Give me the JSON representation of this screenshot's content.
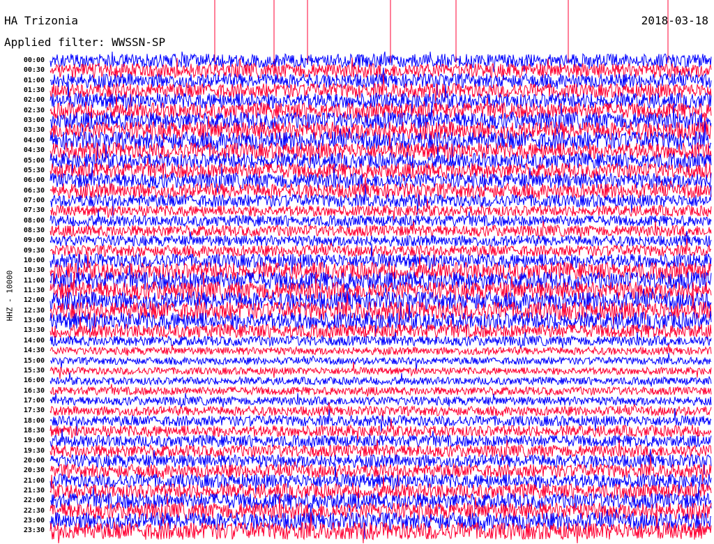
{
  "header": {
    "station": "HA Trizonia",
    "date": "2018-03-18",
    "filter": "Applied filter: WWSSN-SP",
    "channel": "HHZ - 10000"
  },
  "chart_data": {
    "type": "line",
    "title": "HA Trizonia",
    "subtitle": "Applied filter: WWSSN-SP",
    "ylabel": "HHZ - 10000",
    "xlabel": "",
    "rows": [
      "00:00",
      "00:30",
      "01:00",
      "01:30",
      "02:00",
      "02:30",
      "03:00",
      "03:30",
      "04:00",
      "04:30",
      "05:00",
      "05:30",
      "06:00",
      "06:30",
      "07:00",
      "07:30",
      "08:00",
      "08:30",
      "09:00",
      "09:30",
      "10:00",
      "10:30",
      "11:00",
      "11:30",
      "12:00",
      "12:30",
      "13:00",
      "13:30",
      "14:00",
      "14:30",
      "15:00",
      "15:30",
      "16:00",
      "16:30",
      "17:00",
      "17:30",
      "18:00",
      "18:30",
      "19:00",
      "19:30",
      "20:00",
      "20:30",
      "21:00",
      "21:30",
      "22:00",
      "22:30",
      "23:00",
      "23:30"
    ],
    "amplitude": [
      0.75,
      0.8,
      0.78,
      0.8,
      0.85,
      0.88,
      0.95,
      1.0,
      1.0,
      0.9,
      0.85,
      0.85,
      0.85,
      0.82,
      0.7,
      0.6,
      0.6,
      0.62,
      0.6,
      0.62,
      0.78,
      0.95,
      1.0,
      1.0,
      1.0,
      1.0,
      0.95,
      0.75,
      0.55,
      0.42,
      0.4,
      0.4,
      0.42,
      0.45,
      0.48,
      0.52,
      0.58,
      0.62,
      0.65,
      0.68,
      0.72,
      0.75,
      0.78,
      0.82,
      0.88,
      0.92,
      0.95,
      0.95
    ],
    "colors": [
      "#0000ff",
      "#ff0033"
    ],
    "grid": false,
    "legend": "none"
  }
}
